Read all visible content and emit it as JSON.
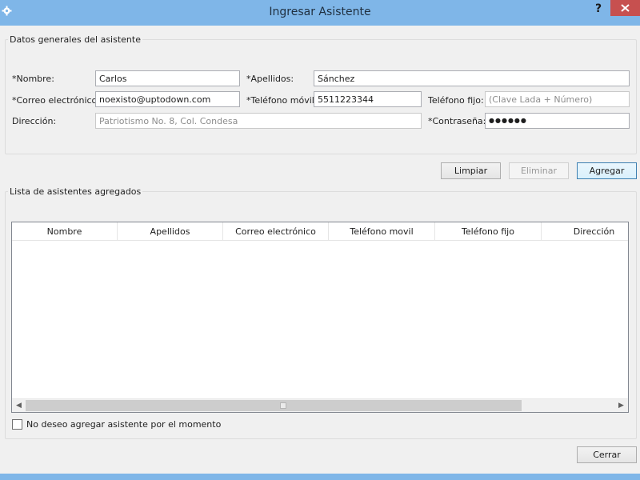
{
  "window": {
    "title": "Ingresar Asistente",
    "help_label": "?"
  },
  "general": {
    "legend": "Datos generales del asistente",
    "nombre_label": "*Nombre:",
    "nombre_value": "Carlos",
    "apellidos_label": "*Apellidos:",
    "apellidos_value": "Sánchez",
    "correo_label": "*Correo electrónico:",
    "correo_value": "noexisto@uptodown.com",
    "movil_label": "*Teléfono móvil:",
    "movil_value": "5511223344",
    "fijo_label": "Teléfono fijo:",
    "fijo_placeholder": "(Clave Lada + Número)",
    "direccion_label": "Dirección:",
    "direccion_placeholder": "Patriotismo No. 8, Col. Condesa",
    "contrasena_label": "*Contraseña:",
    "contrasena_value": "●●●●●●"
  },
  "actions": {
    "limpiar": "Limpiar",
    "eliminar": "Eliminar",
    "agregar": "Agregar"
  },
  "list": {
    "legend": "Lista de asistentes agregados",
    "columns": [
      "Nombre",
      "Apellidos",
      "Correo electrónico",
      "Teléfono movil",
      "Teléfono fijo",
      "Dirección"
    ],
    "rows": [],
    "scroll_left": "◀",
    "scroll_right": "▶"
  },
  "skip_checkbox": {
    "label": "No deseo agregar asistente por el momento",
    "checked": false
  },
  "footer": {
    "cerrar": "Cerrar"
  },
  "colors": {
    "titlebar": "#7fb6e8",
    "close_button": "#c7504f",
    "primary_border": "#3c7fb1"
  }
}
